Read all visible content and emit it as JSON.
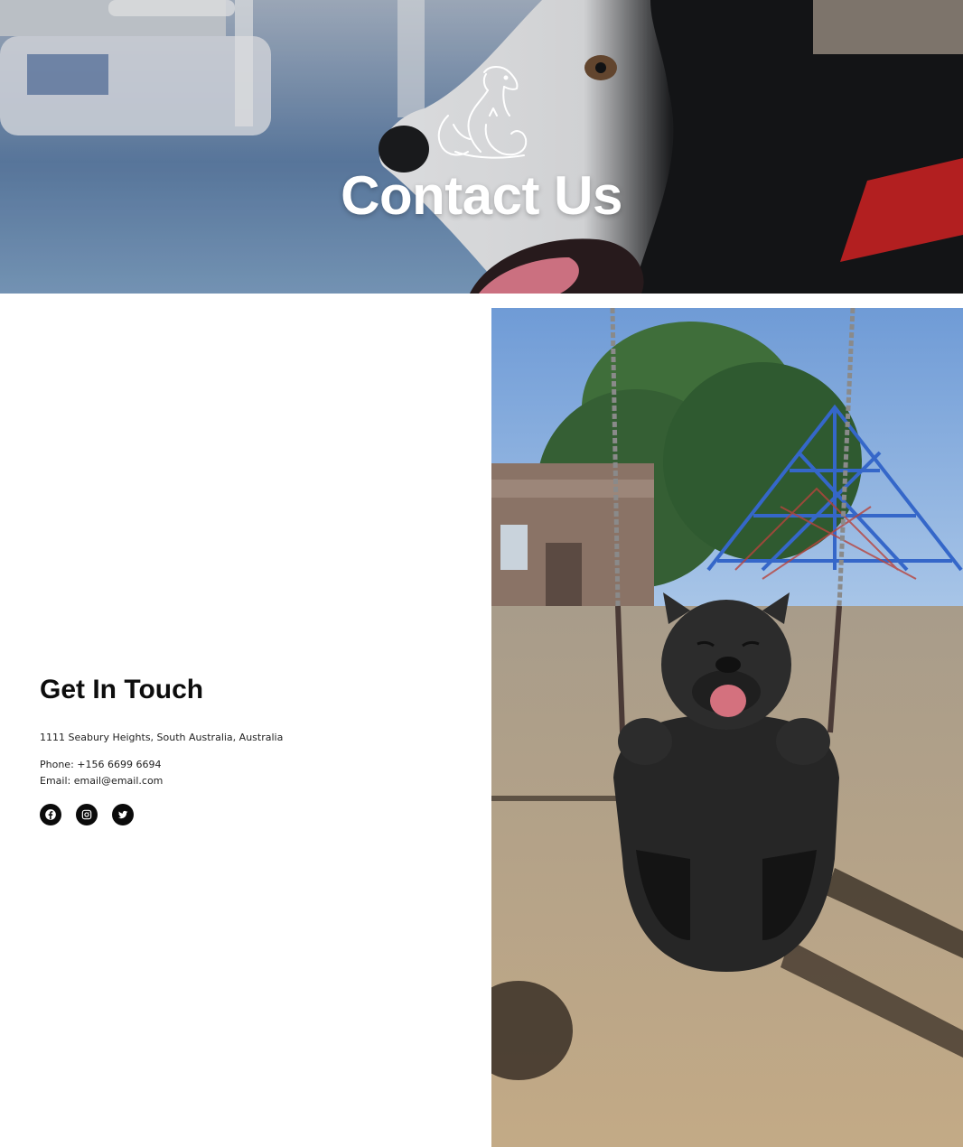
{
  "hero": {
    "title": "Contact Us",
    "logo_icon": "dog-cat-logo-icon",
    "image": "husky-dog-photo"
  },
  "contact": {
    "title": "Get In Touch",
    "address": "1111 Seabury Heights, South Australia, Australia",
    "phone": "Phone: +156 6699 6694",
    "email": "Email: email@email.com",
    "socials": [
      {
        "icon": "facebook-icon"
      },
      {
        "icon": "instagram-icon"
      },
      {
        "icon": "twitter-icon"
      }
    ]
  },
  "photo": {
    "image": "french-bulldog-swing-photo"
  }
}
